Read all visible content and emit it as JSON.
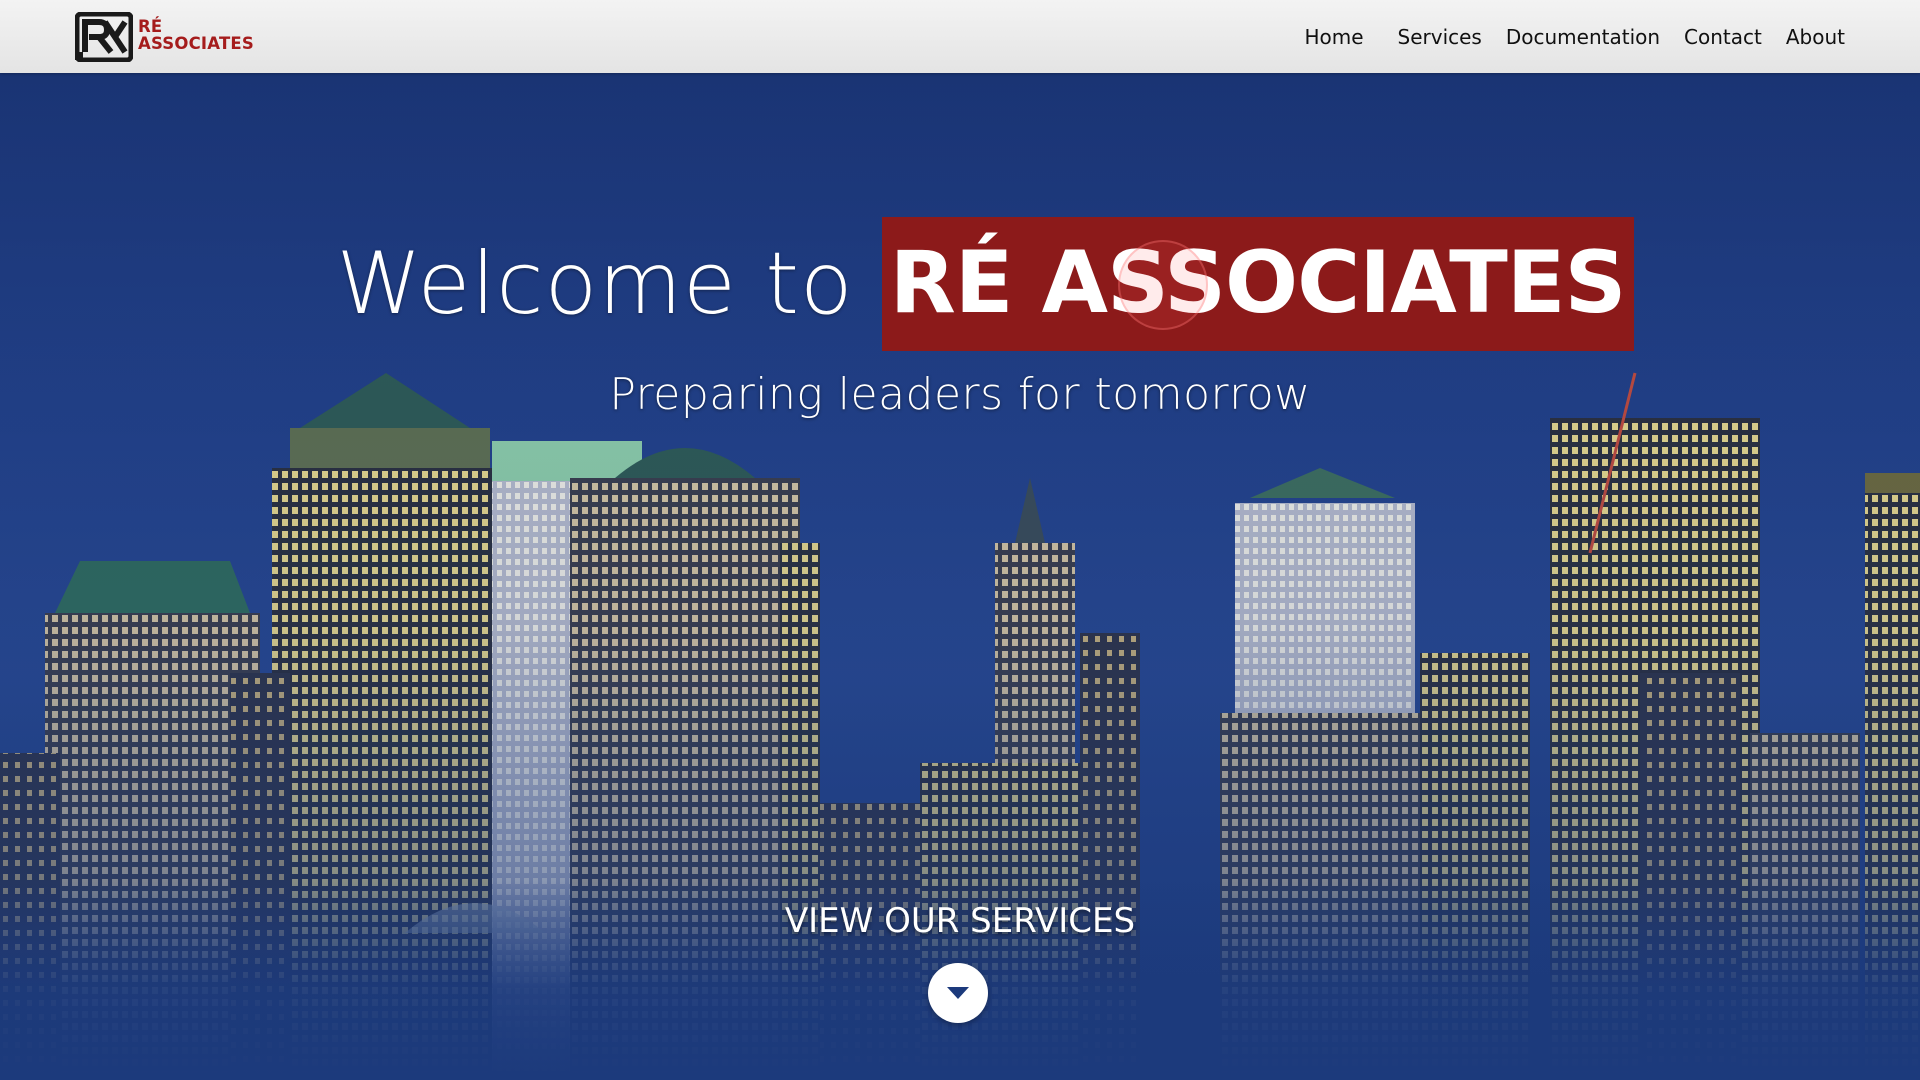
{
  "header": {
    "logo": {
      "line1": "RÉ",
      "line2": "ASSOCIATES",
      "color": "#a51c1c",
      "icon": "re-monogram-icon"
    },
    "nav": [
      {
        "label": "Home"
      },
      {
        "label": "Services"
      },
      {
        "label": "Documentation"
      },
      {
        "label": "Contact"
      },
      {
        "label": "About"
      }
    ]
  },
  "hero": {
    "title_prefix": "Welcome to",
    "title_brand": "RÉ ASSOCIATES",
    "brand_bg_color": "#8c1a1a",
    "tagline": "Preparing leaders for tomorrow",
    "cta_label": "VIEW OUR SERVICES",
    "cta_icon": "caret-down-icon",
    "background": "city-skyline-at-dusk-image"
  }
}
